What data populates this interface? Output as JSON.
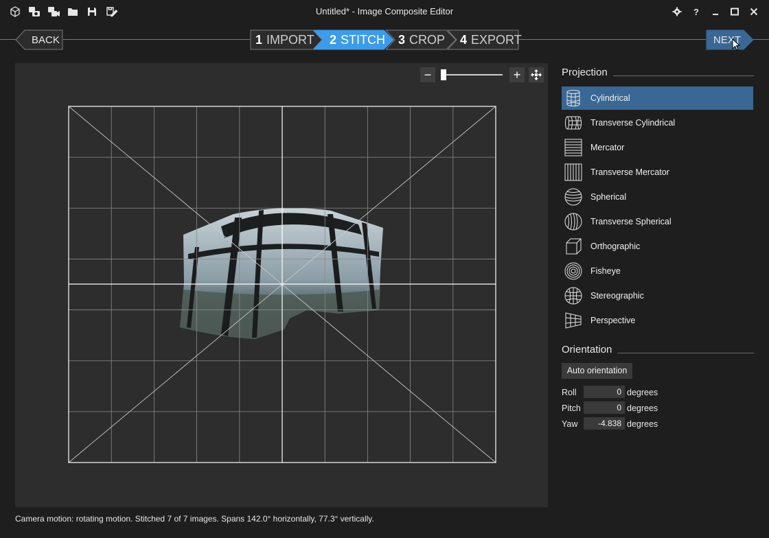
{
  "window": {
    "title": "Untitled* - Image Composite Editor",
    "quick_access_icons": [
      "new-project-icon",
      "new-from-camera-icon",
      "new-from-video-icon",
      "open-folder-icon",
      "save-icon",
      "save-as-icon"
    ],
    "controls": [
      "settings-icon",
      "help-icon",
      "minimize-icon",
      "maximize-icon",
      "close-icon"
    ]
  },
  "steps": {
    "back_label": "BACK",
    "next_label": "NEXT",
    "items": [
      {
        "number": "1",
        "label": "IMPORT"
      },
      {
        "number": "2",
        "label": "STITCH",
        "active": true
      },
      {
        "number": "3",
        "label": "CROP"
      },
      {
        "number": "4",
        "label": "EXPORT"
      }
    ]
  },
  "zoom": {
    "minus": "−",
    "plus": "+",
    "level": 0.0
  },
  "status": "Camera motion: rotating motion. Stitched 7 of 7 images. Spans 142.0° horizontally, 77.3° vertically.",
  "projection": {
    "title": "Projection",
    "items": [
      {
        "label": "Cylindrical",
        "icon": "cylindrical-icon",
        "selected": true
      },
      {
        "label": "Transverse Cylindrical",
        "icon": "transverse-cylindrical-icon"
      },
      {
        "label": "Mercator",
        "icon": "mercator-icon"
      },
      {
        "label": "Transverse Mercator",
        "icon": "transverse-mercator-icon"
      },
      {
        "label": "Spherical",
        "icon": "spherical-icon"
      },
      {
        "label": "Transverse Spherical",
        "icon": "transverse-spherical-icon"
      },
      {
        "label": "Orthographic",
        "icon": "orthographic-icon"
      },
      {
        "label": "Fisheye",
        "icon": "fisheye-icon"
      },
      {
        "label": "Stereographic",
        "icon": "stereographic-icon"
      },
      {
        "label": "Perspective",
        "icon": "perspective-icon"
      }
    ]
  },
  "orientation": {
    "title": "Orientation",
    "auto_button": "Auto orientation",
    "roll": {
      "label": "Roll",
      "value": "0",
      "unit": "degrees"
    },
    "pitch": {
      "label": "Pitch",
      "value": "0",
      "unit": "degrees"
    },
    "yaw": {
      "label": "Yaw",
      "value": "-4.838",
      "unit": "degrees"
    }
  },
  "colors": {
    "accent": "#3a6794",
    "active_step": "#3d9be9",
    "background": "#1e1e1e",
    "canvas": "#2d2d2d"
  }
}
